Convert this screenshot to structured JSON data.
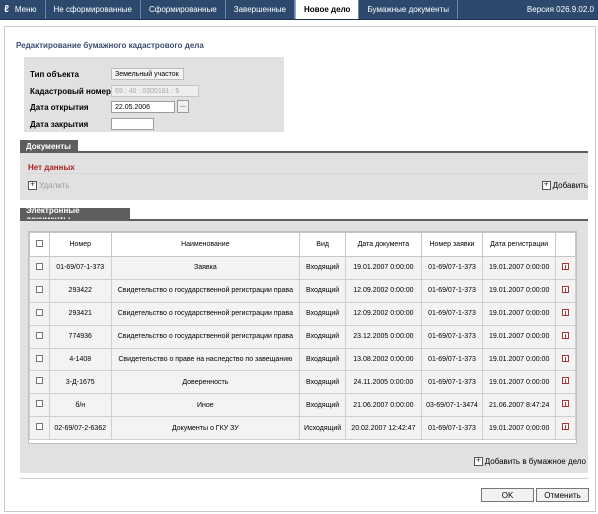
{
  "nav": {
    "menu_label": "Меню",
    "tabs": [
      "Не сформированные",
      "Сформированные",
      "Завершенные",
      "Новое дело",
      "Бумажные документы"
    ],
    "active_tab": 3,
    "version": "Версия 026.9.02.0"
  },
  "page_title": "Редактирование бумажного кадастрового дела",
  "form": {
    "object_type_label": "Тип объекта",
    "object_type_value": "Земельный участок",
    "cadastral_number_label": "Кадастровый номер",
    "cadastral_number_value": "69 : 40 : 0300181 : 5",
    "open_date_label": "Дата открытия",
    "open_date_value": "22.05.2006",
    "calendar_button": "...",
    "close_date_label": "Дата закрытия",
    "close_date_value": ""
  },
  "documents": {
    "header": "Документы",
    "empty_text": "Нет данных",
    "delete_label": "Удалить",
    "add_label": "Добавить"
  },
  "edocs": {
    "header": "Электронные документы",
    "columns": [
      "Номер",
      "Наименование",
      "Вид",
      "Дата документа",
      "Номер заявки",
      "Дата регистрации"
    ],
    "rows": [
      [
        "01-69/07-1-373",
        "Заявка",
        "Входящий",
        "19.01.2007 0:00:00",
        "01-69/07-1-373",
        "19.01.2007 0:00:00"
      ],
      [
        "293422",
        "Свидетельство о государственной регистрации права",
        "Входящий",
        "12.09.2002 0:00:00",
        "01-69/07-1-373",
        "19.01.2007 0:00:00"
      ],
      [
        "293421",
        "Свидетельство о государственной регистрации права",
        "Входящий",
        "12.09.2002 0:00:00",
        "01-69/07-1-373",
        "19.01.2007 0:00:00"
      ],
      [
        "774936",
        "Свидетельство о государственной регистрации права",
        "Входящий",
        "23.12.2005 0:00:00",
        "01-69/07-1-373",
        "19.01.2007 0:00:00"
      ],
      [
        "4-1408",
        "Свидетельство о праве на наследство по завещанию",
        "Входящий",
        "13.08.2002 0:00:00",
        "01-69/07-1-373",
        "19.01.2007 0:00:00"
      ],
      [
        "3-Д-1675",
        "Доверенность",
        "Входящий",
        "24.11.2005 0:00:00",
        "01-69/07-1-373",
        "19.01.2007 0:00:00"
      ],
      [
        "б/н",
        "Иное",
        "Входящий",
        "21.06.2007 0:00:00",
        "03-69/07-1-3474",
        "21.06.2007 8:47:24"
      ],
      [
        "02-69/07-2-6362",
        "Документы о ГКУ ЗУ",
        "Исходящий",
        "20.02.2007 12:42:47",
        "01-69/07-1-373",
        "19.01.2007 0:00:00"
      ]
    ],
    "add_to_paper_label": "Добавить в бумажное дело"
  },
  "buttons": {
    "ok": "OK",
    "cancel": "Отменить"
  },
  "colors": {
    "nav_bg": "#2d4a6e",
    "section_header": "#5e5e5e",
    "panel_bg": "#e1e1e1",
    "no_data": "#b02020"
  }
}
